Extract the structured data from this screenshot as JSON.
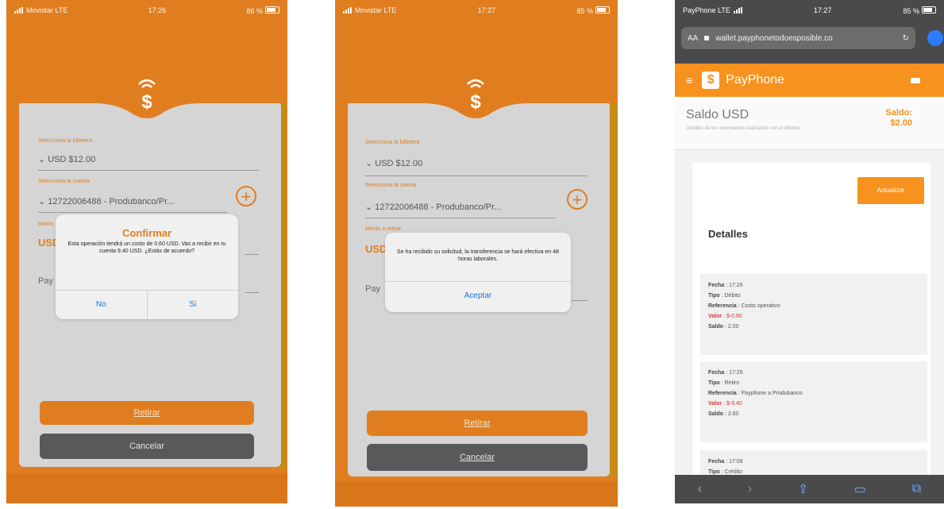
{
  "colors": {
    "brand_orange": "#e07e1f",
    "card_grey": "#d5d5d5",
    "dark_button": "#58595b",
    "link_blue": "#1a73e8",
    "payphone_orange": "#f7921e"
  },
  "screen1": {
    "status": {
      "carrier": "Movistar LTE",
      "time": "17:26",
      "battery": "86 %"
    },
    "logo_icon": "dollar-wireless-icon",
    "fields": [
      {
        "label": "Selecciona la billetera",
        "value": "USD $12.00"
      },
      {
        "label": "Selecciona la cuenta",
        "value": "12722006488 - Produbanco/Pr..."
      }
    ],
    "peek": {
      "label": "Monto",
      "usd": "USD",
      "pay": "Pay"
    },
    "dialog": {
      "title": "Confirmar",
      "message": "Esta operación tendrá un costo de 0.60 USD. Vas a recibir en tu cuenta 9.40 USD. ¿Estás de acuerdo?",
      "no": "No",
      "yes": "Si"
    },
    "buttons": {
      "withdraw": "Retirar",
      "cancel": "Cancelar"
    }
  },
  "screen2": {
    "status": {
      "carrier": "Movistar LTE",
      "time": "17:27",
      "battery": "85 %"
    },
    "fields": [
      {
        "label": "Selecciona la billetera",
        "value": "USD $12.00"
      },
      {
        "label": "Selecciona la cuenta",
        "value": "12722006488 - Produbanco/Pr..."
      }
    ],
    "peek": {
      "label": "Monto a retirar",
      "usd": "USD",
      "pay": "Pay"
    },
    "dialog": {
      "message": "Se ha recibido su solicitud, la transferencia se hará efectiva en 48 horas laborales.",
      "accept": "Aceptar"
    },
    "buttons": {
      "withdraw": "Retirar",
      "cancel": "Cancelar"
    }
  },
  "screen3": {
    "status": {
      "carrier": "PayPhone LTE",
      "time": "17:27",
      "battery": "85 %"
    },
    "url": "wallet.payphonetodoesposible.co",
    "aa": "AA",
    "brand": "PayPhone",
    "balance": {
      "title": "Saldo USD",
      "desc": "Detalles de los movimientos realizados con el billetera",
      "label": "Saldo:",
      "amount": "$2.00"
    },
    "update_button": "Actualizar",
    "details_title": "Detalles",
    "transactions": [
      {
        "fecha": "17:26",
        "tipo": "Débito",
        "referencia": "Costo operativo",
        "valor": "$-0.60",
        "saldo": "2.00"
      },
      {
        "fecha": "17:26",
        "tipo": "Retiro",
        "referencia": "Payphone a Produbanco",
        "valor": "$-9.40",
        "saldo": "2.60"
      },
      {
        "fecha": "17:08",
        "tipo": "Crédito",
        "referencia": "",
        "valor": "",
        "saldo": ""
      }
    ],
    "labels": {
      "fecha": "Fecha",
      "tipo": "Tipo",
      "referencia": "Referencia",
      "valor": "Valor",
      "saldo": "Saldo"
    }
  }
}
